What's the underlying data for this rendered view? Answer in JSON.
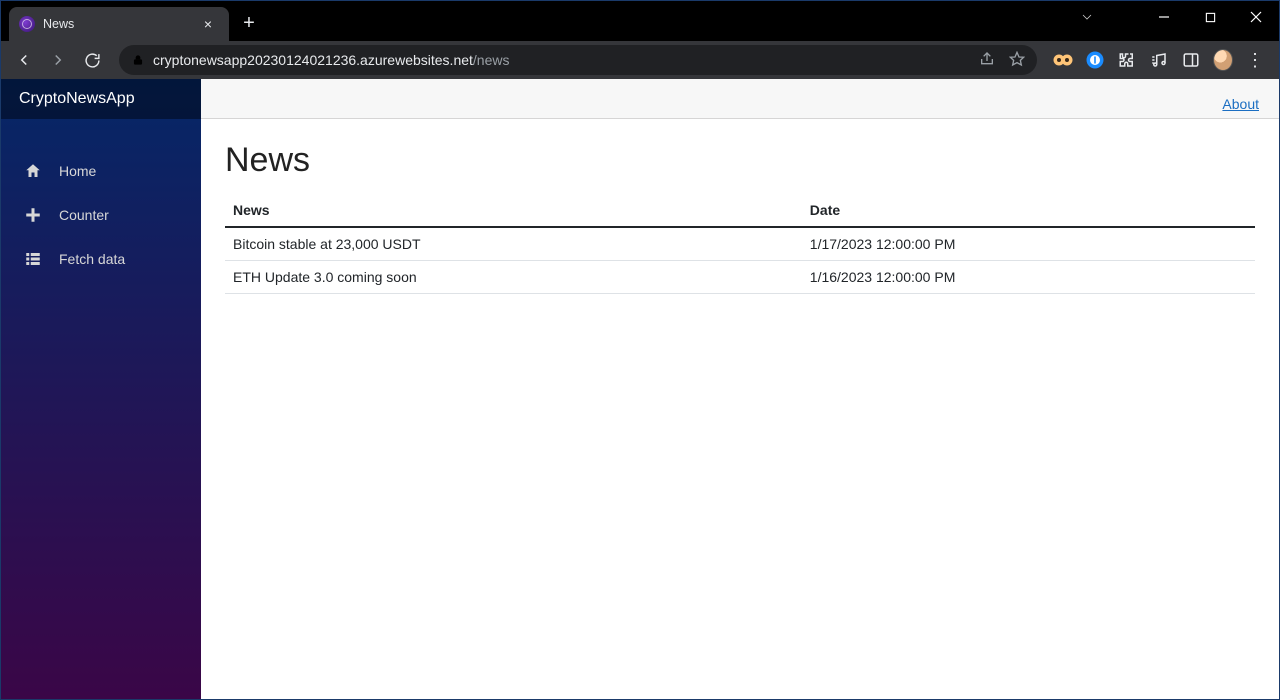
{
  "browser": {
    "tab_title": "News",
    "url_host": "cryptonewsapp20230124021236.azurewebsites.net",
    "url_path": "/news"
  },
  "app": {
    "brand": "CryptoNewsApp",
    "nav": [
      {
        "icon": "home-icon",
        "label": "Home"
      },
      {
        "icon": "plus-icon",
        "label": "Counter"
      },
      {
        "icon": "list-icon",
        "label": "Fetch data"
      }
    ],
    "topbar": {
      "about": "About"
    }
  },
  "page": {
    "heading": "News",
    "columns": {
      "news": "News",
      "date": "Date"
    },
    "rows": [
      {
        "news": "Bitcoin stable at 23,000 USDT",
        "date": "1/17/2023 12:00:00 PM"
      },
      {
        "news": "ETH Update 3.0 coming soon",
        "date": "1/16/2023 12:00:00 PM"
      }
    ]
  }
}
